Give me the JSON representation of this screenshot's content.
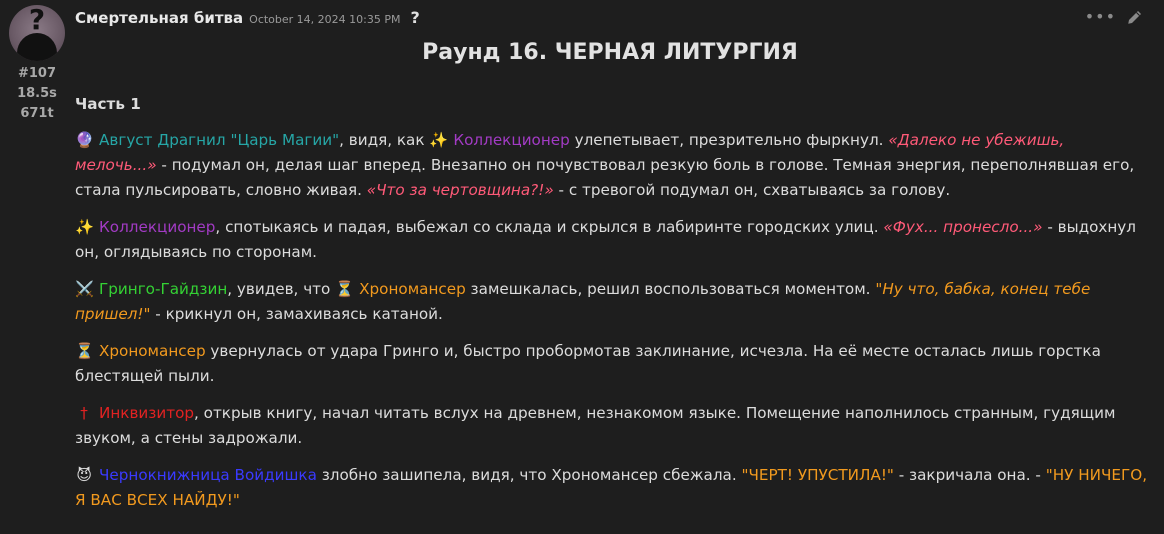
{
  "post": {
    "username": "Смертельная битва",
    "date": "October 14, 2024 10:35 PM",
    "question_mark": "?",
    "avatar_glyph": "?",
    "stats": [
      "#107",
      "18.5s",
      "671t"
    ],
    "actions_dots": "•••",
    "title": "Раунд 16. ЧЕРНАЯ ЛИТУРГИЯ",
    "part": "Часть 1"
  },
  "colors": {
    "teal": "#26a6a6",
    "purple": "#a23bc4",
    "pink": "#ff5a78",
    "green": "#34d134",
    "orange": "#f29a1e",
    "red": "#e22222",
    "blue": "#3a3aff"
  },
  "paragraphs": {
    "p1": {
      "icon": "🔮",
      "name1": "Август Драгнил \"Царь Магии\"",
      "t1": ", видя, как ",
      "icon2": "✨",
      "name2": "Коллекционер",
      "t2": " улепетывает, презрительно фыркнул. ",
      "q1": "«Далеко не убежишь, мелочь...»",
      "t3": " - подумал он, делая шаг вперед. Внезапно он почувствовал резкую боль в голове. Темная энергия, переполнявшая его, стала пульсировать, словно живая. ",
      "q2": "«Что за чертовщина?!»",
      "t4": " - с тревогой подумал он, схватываясь за голову."
    },
    "p2": {
      "icon": "✨",
      "name": "Коллекционер",
      "t1": ", спотыкаясь и падая, выбежал со склада и скрылся в лабиринте городских улиц. ",
      "q1": "«Фух... пронесло...»",
      "t2": " - выдохнул он, оглядываясь по сторонам."
    },
    "p3": {
      "icon": "⚔️",
      "name1": "Гринго-Гайдзин",
      "t1": ", увидев, что ",
      "icon2": "⏳",
      "name2": "Хрономансер",
      "t2": " замешкалась, решил воспользоваться моментом. ",
      "q1": "\"Ну что, бабка, конец тебе пришел!\"",
      "t3": " - крикнул он, замахиваясь катаной."
    },
    "p4": {
      "icon": "⏳",
      "name": "Хрономансер",
      "t1": " увернулась от удара Гринго и, быстро пробормотав заклинание, исчезла. На её месте осталась лишь горстка блестящей пыли."
    },
    "p5": {
      "icon": "†",
      "name": "Инквизитор",
      "t1": ", открыв книгу, начал читать вслух на древнем, незнакомом языке. Помещение наполнилось странным, гудящим звуком, а стены задрожали."
    },
    "p6": {
      "icon": "😈",
      "name": "Чернокнижница Войдишка",
      "t1": " злобно зашипела, видя, что Хрономансер сбежала. ",
      "q1": "\"ЧЕРТ! УПУСТИЛА!\"",
      "t2": " - закричала она. - ",
      "q2": "\"НУ НИЧЕГО, Я ВАС ВСЕХ НАЙДУ!\""
    }
  }
}
